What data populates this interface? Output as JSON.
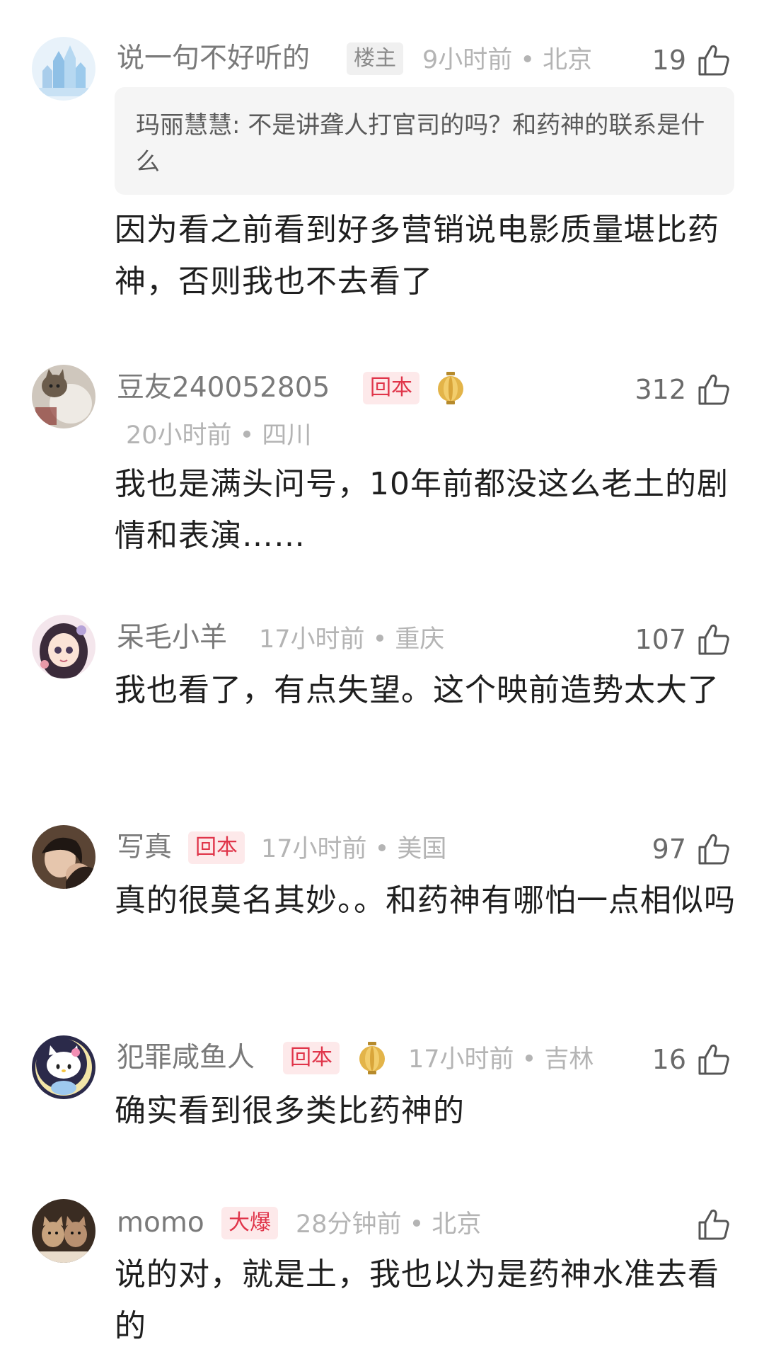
{
  "comments": [
    {
      "name": "说一句不好听的",
      "badge": "楼主",
      "time_location": "9小时前 • 北京",
      "likes": "19",
      "quote": "玛丽慧慧: 不是讲聋人打官司的吗？和药神的联系是什么",
      "text": "因为看之前看到好多营销说电影质量堪比药神，否则我也不去看了",
      "avatar_icon": "castle-avatar-icon"
    },
    {
      "name": "豆友240052805",
      "badge": "回本",
      "time_location": "20小时前 • 四川",
      "likes": "312",
      "text": "我也是满头问号，10年前都没这么老土的剧情和表演……",
      "avatar_icon": "cat-avatar-icon"
    },
    {
      "name": "呆毛小羊",
      "time_location": "17小时前 • 重庆",
      "likes": "107",
      "text": "我也看了，有点失望。这个映前造势太大了",
      "avatar_icon": "anime-girl-avatar-icon"
    },
    {
      "name": "写真",
      "badge": "回本",
      "time_location": "17小时前 • 美国",
      "likes": "97",
      "text": "真的很莫名其妙。。和药神有哪怕一点相似吗",
      "avatar_icon": "portrait-avatar-icon"
    },
    {
      "name": "犯罪咸鱼人",
      "badge": "回本",
      "time_location": "17小时前 • 吉林",
      "likes": "16",
      "text": "确实看到很多类比药神的",
      "avatar_icon": "hello-kitty-avatar-icon"
    },
    {
      "name": "momo",
      "badge": "大爆",
      "time_location": "28分钟前 • 北京",
      "likes": "",
      "text": "说的对，就是土，我也以为是药神水准去看的",
      "avatar_icon": "cats-avatar-icon"
    }
  ],
  "colors": {
    "badge_red_text": "#e0354a",
    "badge_red_bg": "#fde9ea",
    "meta_gray": "#b4b4b4",
    "name_gray": "#7a7a7a",
    "quote_bg": "#f5f5f5"
  }
}
